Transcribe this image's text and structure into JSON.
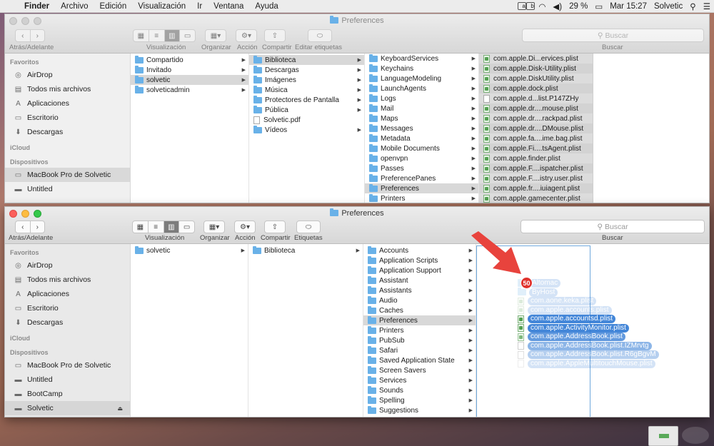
{
  "menubar": {
    "app": "Finder",
    "items": [
      "Archivo",
      "Edición",
      "Visualización",
      "Ir",
      "Ventana",
      "Ayuda"
    ],
    "battery": "29 %",
    "clock": "Mar 15:27",
    "user": "Solvetic"
  },
  "window1": {
    "title": "Preferences",
    "toolbar": {
      "nav_label": "Atrás/Adelante",
      "view_label": "Visualización",
      "arrange_label": "Organizar",
      "action_label": "Acción",
      "share_label": "Compartir",
      "tags_label": "Editar etiquetas",
      "search_placeholder": "Buscar",
      "search_label": "Buscar"
    },
    "sidebar": {
      "favorites_header": "Favoritos",
      "favorites": [
        {
          "label": "AirDrop",
          "icon": "airdrop-icon"
        },
        {
          "label": "Todos mis archivos",
          "icon": "all-files-icon"
        },
        {
          "label": "Aplicaciones",
          "icon": "applications-icon"
        },
        {
          "label": "Escritorio",
          "icon": "desktop-icon"
        },
        {
          "label": "Descargas",
          "icon": "downloads-icon"
        }
      ],
      "icloud_header": "iCloud",
      "devices_header": "Dispositivos",
      "devices": [
        {
          "label": "MacBook Pro de Solvetic",
          "icon": "laptop-icon",
          "selected": true
        },
        {
          "label": "Untitled",
          "icon": "disk-icon",
          "selected": false
        }
      ]
    },
    "col1": [
      {
        "label": "Compartido",
        "selected": false
      },
      {
        "label": "Invitado",
        "selected": false
      },
      {
        "label": "solvetic",
        "selected": true
      },
      {
        "label": "solveticadmin",
        "selected": false
      }
    ],
    "col2": [
      {
        "label": "Biblioteca",
        "kind": "folder",
        "selected": true,
        "chevron": true
      },
      {
        "label": "Descargas",
        "kind": "folder",
        "selected": false,
        "chevron": true
      },
      {
        "label": "Imágenes",
        "kind": "folder",
        "selected": false,
        "chevron": true
      },
      {
        "label": "Música",
        "kind": "folder",
        "selected": false,
        "chevron": true
      },
      {
        "label": "Protectores de Pantalla",
        "kind": "folder",
        "selected": false,
        "chevron": true
      },
      {
        "label": "Pública",
        "kind": "folder",
        "selected": false,
        "chevron": true
      },
      {
        "label": "Solvetic.pdf",
        "kind": "file",
        "selected": false,
        "chevron": false
      },
      {
        "label": "Vídeos",
        "kind": "folder",
        "selected": false,
        "chevron": true
      }
    ],
    "col3": [
      {
        "label": "KeyboardServices",
        "selected": false
      },
      {
        "label": "Keychains",
        "selected": false
      },
      {
        "label": "LanguageModeling",
        "selected": false
      },
      {
        "label": "LaunchAgents",
        "selected": false
      },
      {
        "label": "Logs",
        "selected": false
      },
      {
        "label": "Mail",
        "selected": false
      },
      {
        "label": "Maps",
        "selected": false
      },
      {
        "label": "Messages",
        "selected": false
      },
      {
        "label": "Metadata",
        "selected": false
      },
      {
        "label": "Mobile Documents",
        "selected": false
      },
      {
        "label": "openvpn",
        "selected": false
      },
      {
        "label": "Passes",
        "selected": false
      },
      {
        "label": "PreferencePanes",
        "selected": false
      },
      {
        "label": "Preferences",
        "selected": true
      },
      {
        "label": "Printers",
        "selected": false
      }
    ],
    "col4": [
      {
        "label": "com.apple.Di...ervices.plist",
        "kind": "plist"
      },
      {
        "label": "com.apple.Disk-Utility.plist",
        "kind": "plist"
      },
      {
        "label": "com.apple.DiskUtility.plist",
        "kind": "plist"
      },
      {
        "label": "com.apple.dock.plist",
        "kind": "plist"
      },
      {
        "label": "com.apple.d...list.P147ZHy",
        "kind": "file"
      },
      {
        "label": "com.apple.dr....mouse.plist",
        "kind": "plist"
      },
      {
        "label": "com.apple.dr....rackpad.plist",
        "kind": "plist"
      },
      {
        "label": "com.apple.dr....DMouse.plist",
        "kind": "plist"
      },
      {
        "label": "com.apple.fa....ime.bag.plist",
        "kind": "plist"
      },
      {
        "label": "com.apple.Fi....tsAgent.plist",
        "kind": "plist"
      },
      {
        "label": "com.apple.finder.plist",
        "kind": "plist"
      },
      {
        "label": "com.apple.F....ispatcher.plist",
        "kind": "plist"
      },
      {
        "label": "com.apple.F....istry.user.plist",
        "kind": "plist"
      },
      {
        "label": "com.apple.fr....iuiagent.plist",
        "kind": "plist"
      },
      {
        "label": "com.apple.gamecenter.plist",
        "kind": "plist"
      }
    ]
  },
  "window2": {
    "title": "Preferences",
    "toolbar": {
      "nav_label": "Atrás/Adelante",
      "view_label": "Visualización",
      "arrange_label": "Organizar",
      "action_label": "Acción",
      "share_label": "Compartir",
      "tags_label": "Etiquetas",
      "search_placeholder": "Buscar",
      "search_label": "Buscar"
    },
    "sidebar": {
      "favorites_header": "Favoritos",
      "favorites": [
        {
          "label": "AirDrop",
          "icon": "airdrop-icon"
        },
        {
          "label": "Todos mis archivos",
          "icon": "all-files-icon"
        },
        {
          "label": "Aplicaciones",
          "icon": "applications-icon"
        },
        {
          "label": "Escritorio",
          "icon": "desktop-icon"
        },
        {
          "label": "Descargas",
          "icon": "downloads-icon"
        }
      ],
      "icloud_header": "iCloud",
      "devices_header": "Dispositivos",
      "devices": [
        {
          "label": "MacBook Pro de Solvetic",
          "icon": "laptop-icon",
          "selected": false,
          "eject": false
        },
        {
          "label": "Untitled",
          "icon": "disk-icon",
          "selected": false,
          "eject": false
        },
        {
          "label": "BootCamp",
          "icon": "disk-icon",
          "selected": false,
          "eject": false
        },
        {
          "label": "Solvetic",
          "icon": "disk-icon",
          "selected": true,
          "eject": true
        }
      ]
    },
    "col1": [
      {
        "label": "solvetic",
        "selected": false
      }
    ],
    "col2": [
      {
        "label": "Biblioteca",
        "selected": false
      }
    ],
    "col3": [
      {
        "label": "Accounts",
        "selected": false
      },
      {
        "label": "Application Scripts",
        "selected": false
      },
      {
        "label": "Application Support",
        "selected": false
      },
      {
        "label": "Assistant",
        "selected": false
      },
      {
        "label": "Assistants",
        "selected": false
      },
      {
        "label": "Audio",
        "selected": false
      },
      {
        "label": "Caches",
        "selected": false
      },
      {
        "label": "Preferences",
        "selected": true
      },
      {
        "label": "Printers",
        "selected": false
      },
      {
        "label": "PubSub",
        "selected": false
      },
      {
        "label": "Safari",
        "selected": false
      },
      {
        "label": "Saved Application State",
        "selected": false
      },
      {
        "label": "Screen Savers",
        "selected": false
      },
      {
        "label": "Services",
        "selected": false
      },
      {
        "label": "Sounds",
        "selected": false
      },
      {
        "label": "Spelling",
        "selected": false
      },
      {
        "label": "Suggestions",
        "selected": false
      }
    ],
    "drag": {
      "badge": "50",
      "items": [
        {
          "label": "Altomac",
          "kind": "folder"
        },
        {
          "label": "ByHost",
          "kind": "folder"
        },
        {
          "label": "com.aone.keka.plist",
          "kind": "plist"
        },
        {
          "label": "com.apple.accounts.plist",
          "kind": "plist"
        },
        {
          "label": "com.apple.accountsd.plist",
          "kind": "plist"
        },
        {
          "label": "com.apple.ActivityMonitor.plist",
          "kind": "plist"
        },
        {
          "label": "com.apple.AddressBook.plist",
          "kind": "plist"
        },
        {
          "label": "com.apple.AddressBook.plist.IZMrvtg",
          "kind": "file"
        },
        {
          "label": "com.apple.AddressBook.plist.R6gBgvM",
          "kind": "file"
        },
        {
          "label": "com.apple.AppleMultitouchMouse.plist",
          "kind": "file"
        }
      ]
    },
    "accent_color": "#2f79d4",
    "arrow_color": "#e8433d"
  }
}
